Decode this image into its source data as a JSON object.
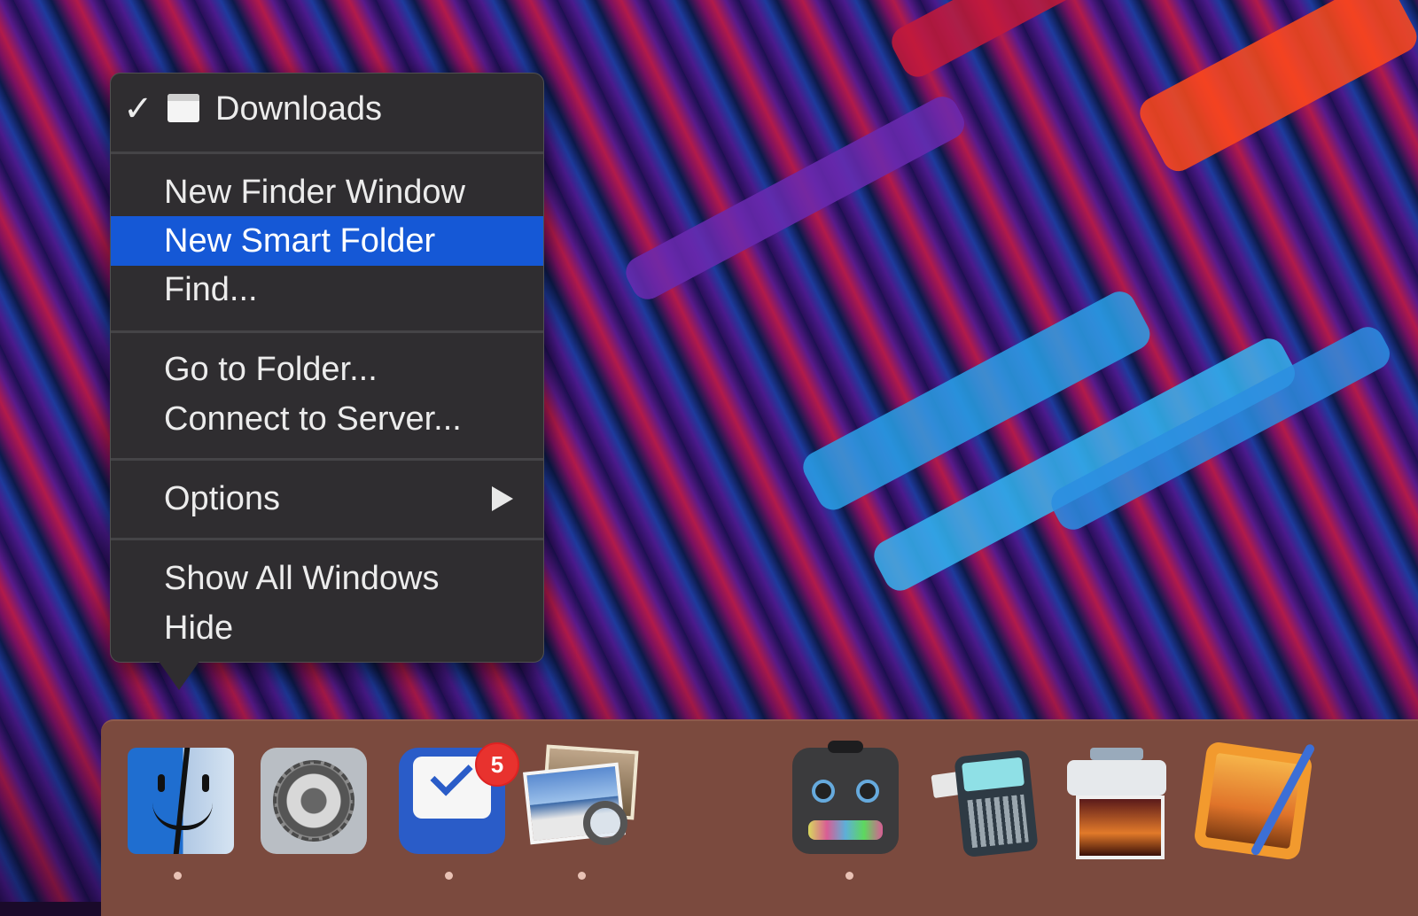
{
  "menu": {
    "header": {
      "checkmark": "✓",
      "icon": "finder-window-icon",
      "label": "Downloads"
    },
    "items": [
      {
        "label": "New Finder Window"
      },
      {
        "label": "New Smart Folder",
        "highlighted": true
      },
      {
        "label": "Find..."
      },
      {
        "label": "Go to Folder..."
      },
      {
        "label": "Connect to Server..."
      },
      {
        "label": "Options",
        "submenu": true
      },
      {
        "label": "Show All Windows"
      },
      {
        "label": "Hide"
      }
    ],
    "highlight_color": "#1558d6"
  },
  "dock": {
    "background_color": "#7b4a3e",
    "apps": [
      {
        "icon": "finder-icon",
        "running": true
      },
      {
        "icon": "system-preferences-icon",
        "running": false
      },
      {
        "icon": "things-icon",
        "running": true,
        "badge": "5"
      },
      {
        "icon": "preview-icon",
        "running": true
      },
      {
        "icon": "audio-robot-icon",
        "running": true
      },
      {
        "icon": "renamer-icon",
        "running": false
      },
      {
        "icon": "image-capture-icon",
        "running": false
      },
      {
        "icon": "pixelmator-icon",
        "running": false
      }
    ]
  }
}
